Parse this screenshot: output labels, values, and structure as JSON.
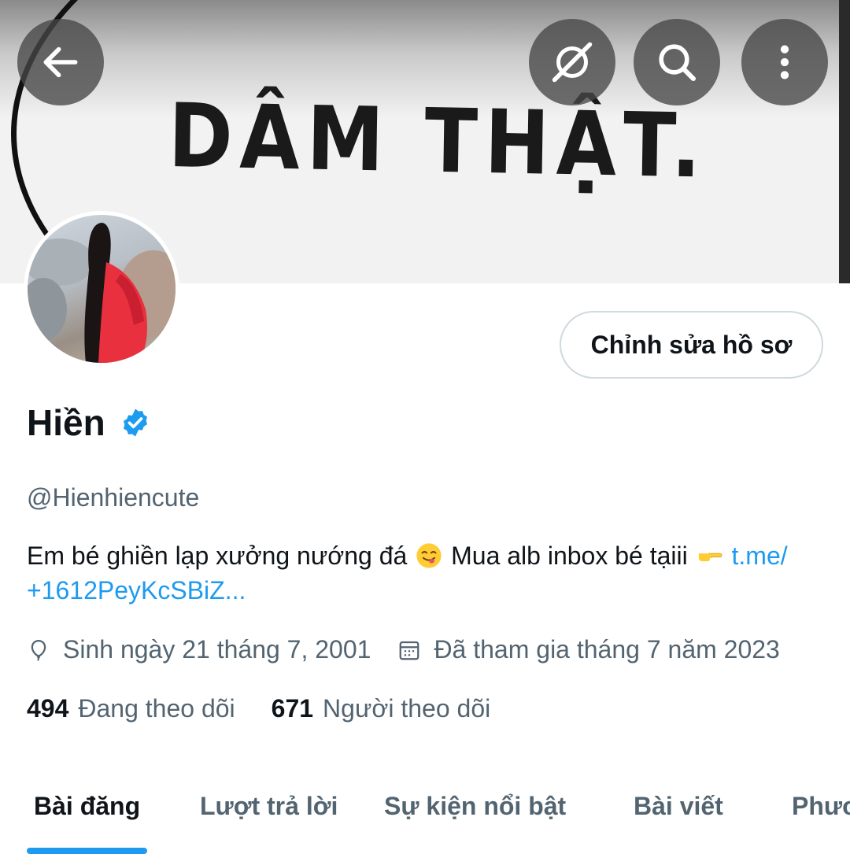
{
  "banner": {
    "text": "DÂM THẬT."
  },
  "top_bar": {
    "back_icon": "arrow-left-icon",
    "explore_icon": "grok-icon",
    "search_icon": "search-icon",
    "more_icon": "more-vertical-icon"
  },
  "profile": {
    "edit_button": "Chỉnh sửa hồ sơ",
    "name": "Hiền",
    "handle": "@Hienhiencute",
    "bio_part1": "Em bé ghiền lạp xưởng nướng đá",
    "bio_part2": "Mua alb inbox bé tạiii",
    "bio_link_part1": "t.me/",
    "bio_link_part2": "+1612PeyKcSBiZ...",
    "birthday": "Sinh ngày 21 tháng 7, 2001",
    "joined": "Đã tham gia tháng 7 năm 2023",
    "following_count": "494",
    "following_label": "Đang theo dõi",
    "followers_count": "671",
    "followers_label": "Người theo dõi"
  },
  "tabs": [
    "Bài đăng",
    "Lượt trả lời",
    "Sự kiện nổi bật",
    "Bài viết",
    "Phương tiện"
  ],
  "colors": {
    "accent": "#1d9bf0",
    "secondary_text": "#536471",
    "primary_text": "#0f1419",
    "border": "#cfd9de"
  }
}
